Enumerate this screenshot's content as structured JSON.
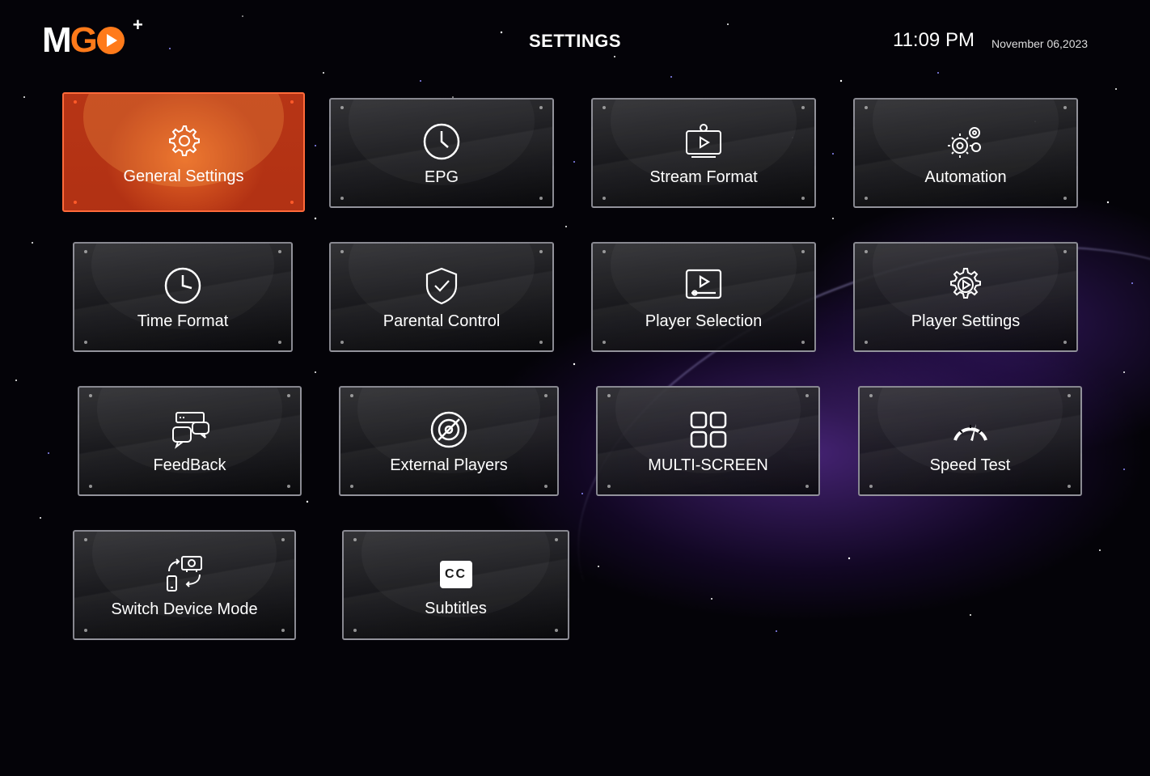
{
  "header": {
    "logo_text": "MGO+",
    "title": "SETTINGS",
    "time": "11:09 PM",
    "date": "November 06,2023"
  },
  "tiles": [
    {
      "label": "General Settings",
      "icon": "gear-icon"
    },
    {
      "label": "EPG",
      "icon": "clock-icon"
    },
    {
      "label": "Stream Format",
      "icon": "stream-tv-icon"
    },
    {
      "label": "Automation",
      "icon": "gears-automation-icon"
    },
    {
      "label": "Time Format",
      "icon": "clock-icon"
    },
    {
      "label": "Parental Control",
      "icon": "shield-check-icon"
    },
    {
      "label": "Player Selection",
      "icon": "player-screen-icon"
    },
    {
      "label": "Player Settings",
      "icon": "gear-play-icon"
    },
    {
      "label": "FeedBack",
      "icon": "feedback-chat-icon"
    },
    {
      "label": "External Players",
      "icon": "disc-icon"
    },
    {
      "label": "MULTI-SCREEN",
      "icon": "grid-icon"
    },
    {
      "label": "Speed Test",
      "icon": "speedometer-icon"
    },
    {
      "label": "Switch Device Mode",
      "icon": "switch-device-icon"
    },
    {
      "label": "Subtitles",
      "icon": "cc-icon",
      "icon_text": "CC"
    }
  ],
  "colors": {
    "accent": "#ff7a1a",
    "active_tile": "#c9451e",
    "background": "#040308"
  }
}
